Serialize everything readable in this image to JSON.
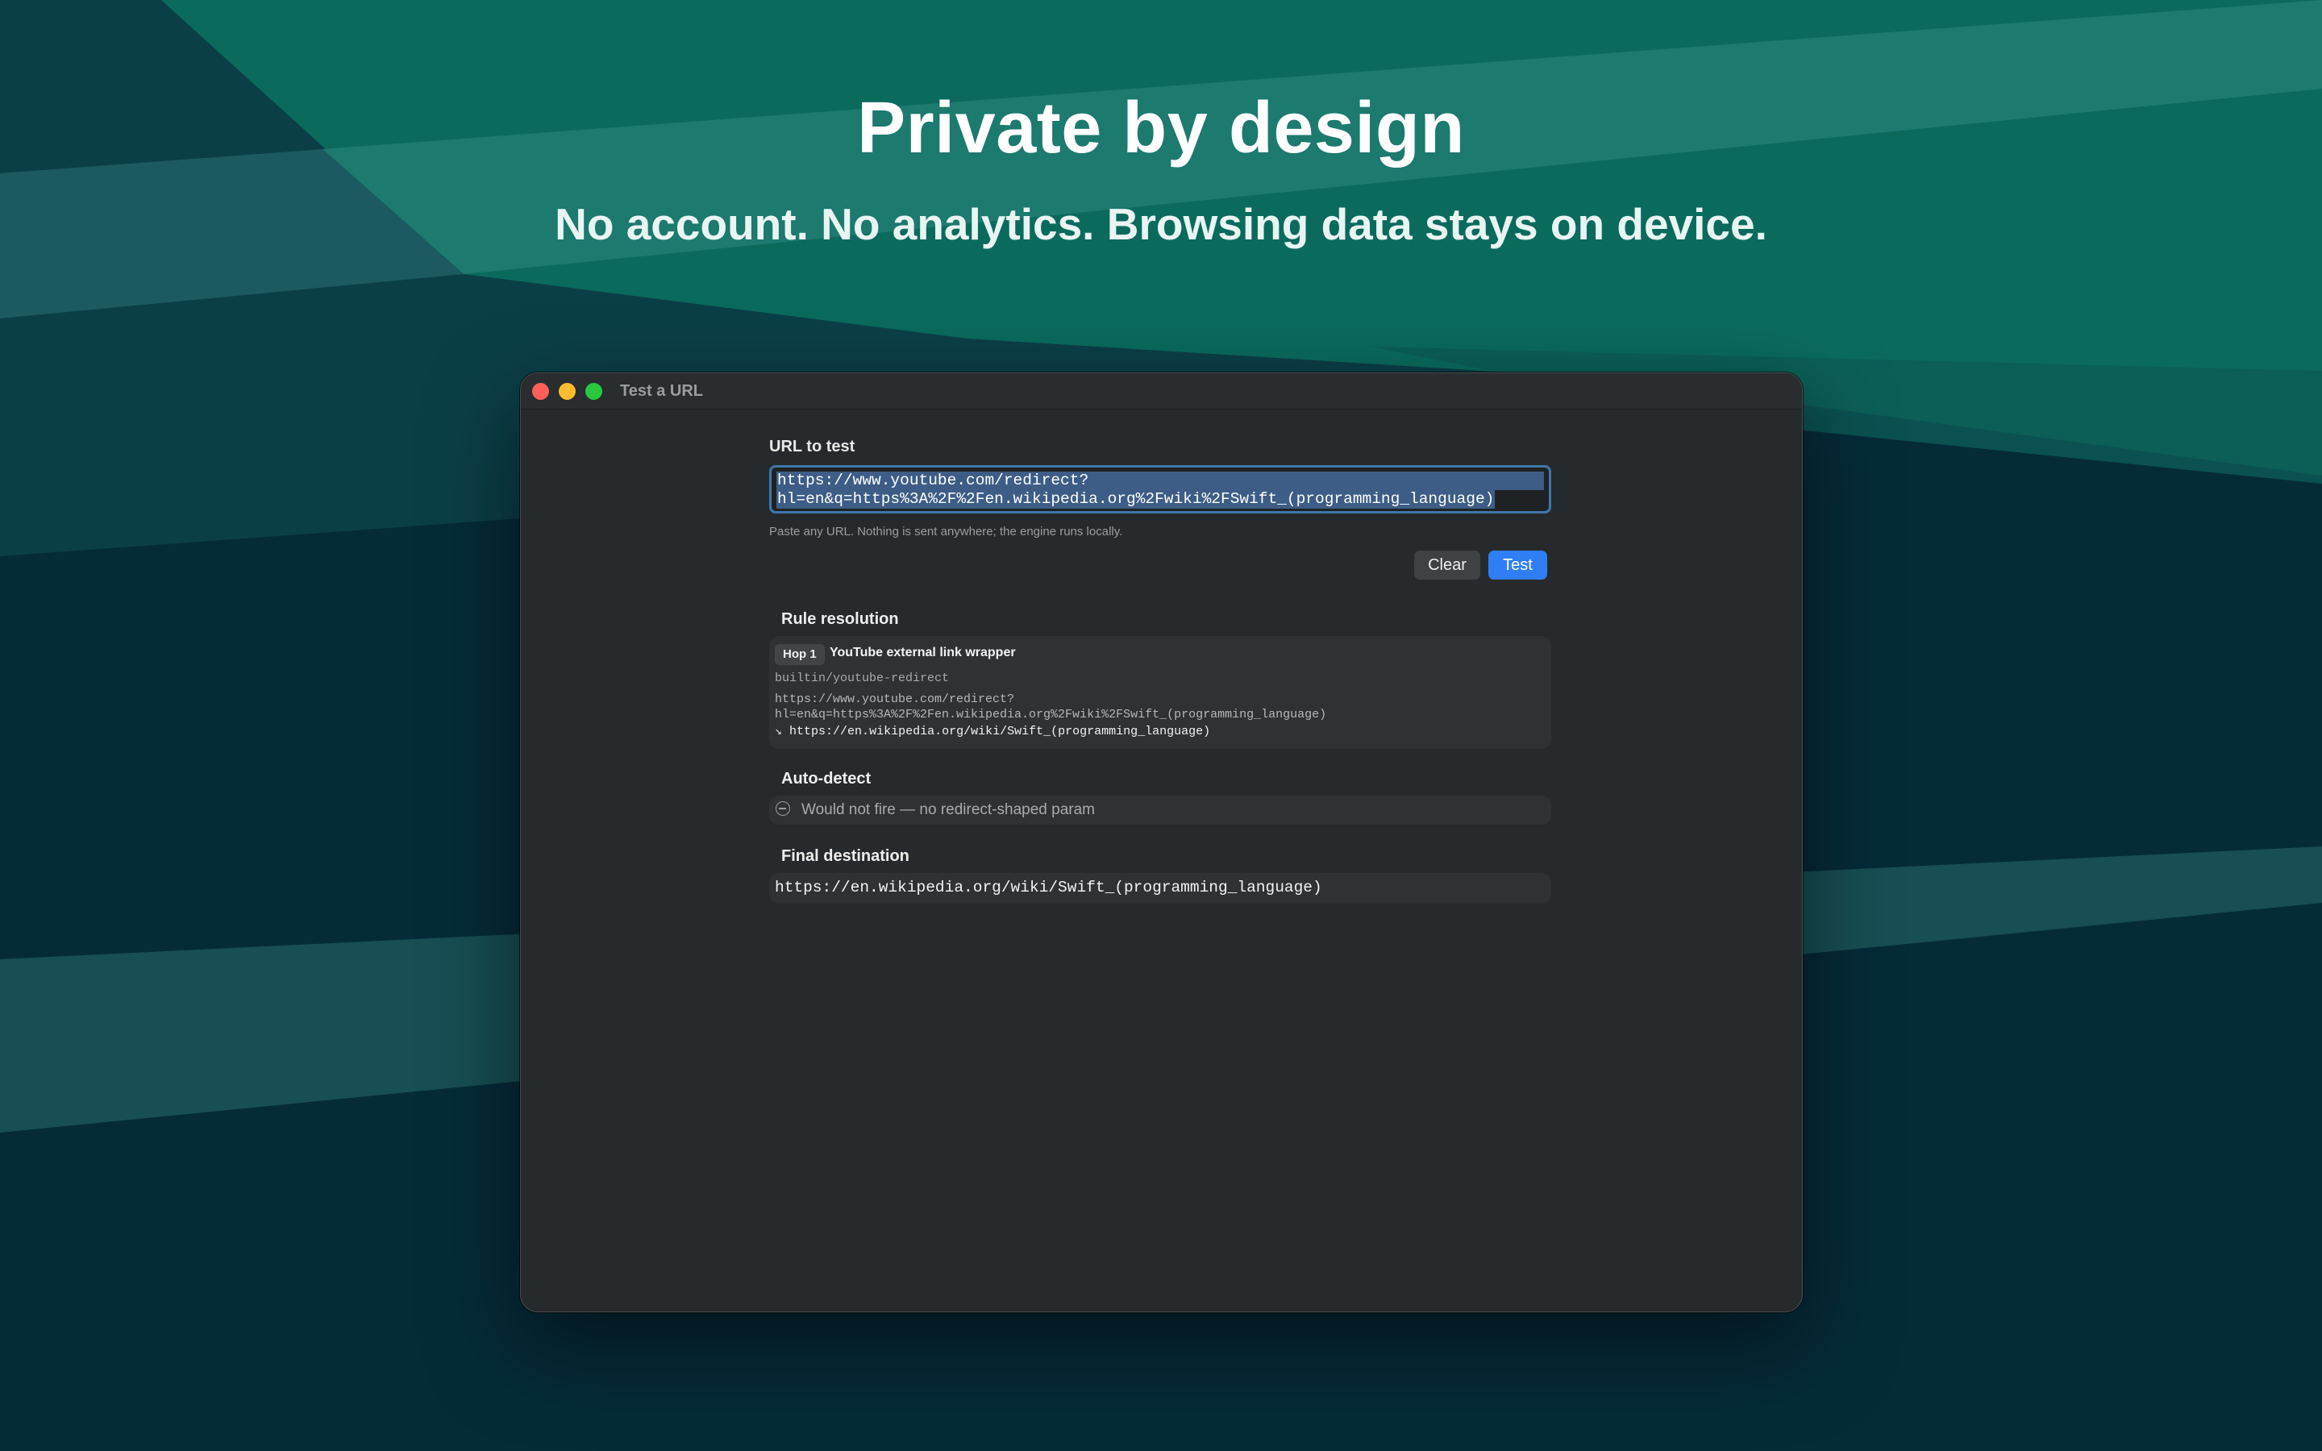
{
  "hero": {
    "title": "Private by design",
    "subtitle": "No account. No analytics. Browsing data stays on device."
  },
  "window": {
    "title": "Test a URL"
  },
  "form": {
    "url_label": "URL to test",
    "url_value_line1": "https://www.youtube.com/redirect?",
    "url_value_line2": "hl=en&q=https%3A%2F%2Fen.wikipedia.org%2Fwiki%2FSwift_(programming_language)",
    "hint": "Paste any URL. Nothing is sent anywhere; the engine runs locally.",
    "clear_label": "Clear",
    "test_label": "Test"
  },
  "rule_resolution": {
    "title": "Rule resolution",
    "hops": [
      {
        "badge": "Hop 1",
        "name": "YouTube external link wrapper",
        "rule_id": "builtin/youtube-redirect",
        "source_line1": "https://www.youtube.com/redirect?",
        "source_line2": "hl=en&q=https%3A%2F%2Fen.wikipedia.org%2Fwiki%2FSwift_(programming_language)",
        "arrow": "↘",
        "output": "https://en.wikipedia.org/wiki/Swift_(programming_language)"
      }
    ]
  },
  "auto_detect": {
    "title": "Auto-detect",
    "result": "Would not fire — no redirect-shaped param"
  },
  "final_destination": {
    "title": "Final destination",
    "url": "https://en.wikipedia.org/wiki/Swift_(programming_language)"
  },
  "colors": {
    "accent": "#2f7ef5",
    "background_teal": "#0a6b5d",
    "background_navy": "#052b39",
    "close": "#fe5f57",
    "minimize": "#febc2e",
    "maximize": "#28c840"
  },
  "icons": {
    "auto_detect": "minus-circle-icon",
    "hop_arrow": "arrow-down-right-icon"
  }
}
